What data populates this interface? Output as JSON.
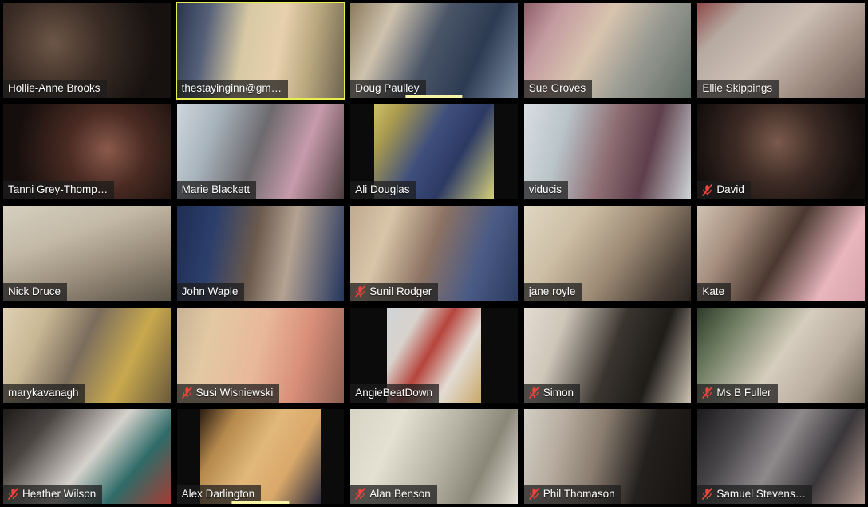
{
  "app": {
    "title": "Video Conference Gallery View",
    "layout": "gallery",
    "columns": 5,
    "rows": 5,
    "background_color": "#000000",
    "active_speaker_border_color": "#e9ef4a",
    "active_speaker_glow_color": "#7ddf22",
    "label_background_color": "rgba(28,28,28,0.74)",
    "label_text_color": "#ffffff",
    "muted_icon_color": "#e8453c",
    "audio_bar_color": "#f7f4a8",
    "participant_count": 25
  },
  "participants": [
    {
      "name": "Hollie-Anne Brooks",
      "muted": false,
      "active_speaker": false,
      "audio_bar": false,
      "mic_icon": "microphone-icon",
      "video": "full",
      "scene": "radial-gradient(circle at 30% 42%, #6d5648 0%, #3b2d25 38%, #171210 78%), linear-gradient(140deg,#9b9277 0%, #5c5443 46%, #1a1613 100%)"
    },
    {
      "name": "thestayinginn@gm…",
      "muted": false,
      "active_speaker": true,
      "audio_bar": false,
      "mic_icon": "microphone-icon",
      "video": "full",
      "scene": "linear-gradient(100deg,#2a3450 0%, #556078 18%, #d8c9a4 40%, #e7d0ae 60%, #b9a77f 78%, #6d6450 100%)"
    },
    {
      "name": "Doug Paulley",
      "muted": false,
      "active_speaker": false,
      "audio_bar": true,
      "mic_icon": "microphone-icon",
      "video": "full",
      "scene": "linear-gradient(115deg,#8b7a5e 0%, #cfc3ae 22%, #4a5568 48%, #2d3b52 72%, #7e8ea3 100%)"
    },
    {
      "name": "Sue Groves",
      "muted": false,
      "active_speaker": false,
      "audio_bar": false,
      "mic_icon": "microphone-icon",
      "video": "full",
      "scene": "linear-gradient(120deg,#8e5f68 0%, #c39aa0 18%, #d8c4ae 42%, #9a9b93 66%, #5e6b63 100%)"
    },
    {
      "name": "Ellie Skippings",
      "muted": false,
      "active_speaker": false,
      "audio_bar": false,
      "mic_icon": "microphone-icon",
      "video": "full",
      "scene": "linear-gradient(135deg,#8e4a4a 0%, #b6a9a0 20%, #cdbfb4 46%, #a39186 70%, #6e5c55 100%)"
    },
    {
      "name": "Tanni Grey-Thomp…",
      "muted": false,
      "active_speaker": false,
      "audio_bar": false,
      "mic_icon": "microphone-icon",
      "video": "full",
      "scene": "radial-gradient(circle at 62% 48%, #8a5a4b 0%, #4a2b23 34%, #150e0c 80%), linear-gradient(150deg,#3a221c 0%, #0c0808 100%)"
    },
    {
      "name": "Marie Blackett",
      "muted": false,
      "active_speaker": false,
      "audio_bar": false,
      "mic_icon": "microphone-icon",
      "video": "full",
      "scene": "linear-gradient(110deg,#cfd6dc 0%, #a8b4bd 22%, #6d6a6e 48%, #c79bab 72%, #4a3c3f 100%)"
    },
    {
      "name": "Ali Douglas",
      "muted": false,
      "active_speaker": false,
      "audio_bar": false,
      "mic_icon": "microphone-icon",
      "video": "pillar-wide",
      "scene": "linear-gradient(120deg,#cfc168 0%, #a99a4f 16%, #3f4f7d 44%, #2c3a63 66%, #d6cf7e 100%)"
    },
    {
      "name": "viducis",
      "muted": false,
      "active_speaker": false,
      "audio_bar": false,
      "mic_icon": "microphone-icon",
      "video": "full",
      "scene": "linear-gradient(105deg,#d8dde2 0%, #b9c4c9 24%, #8f6f74 50%, #5e3f4b 72%, #cfd6d9 100%)"
    },
    {
      "name": "David",
      "muted": true,
      "active_speaker": false,
      "audio_bar": false,
      "mic_icon": "microphone-muted-icon",
      "video": "full",
      "scene": "radial-gradient(circle at 48% 40%, #7a5a4c 0%, #3c2a24 40%, #130e0c 82%), linear-gradient(160deg,#2a1d18 0%, #0a0707 100%)"
    },
    {
      "name": "Nick Druce",
      "muted": false,
      "active_speaker": false,
      "audio_bar": false,
      "mic_icon": "microphone-icon",
      "video": "full",
      "scene": "linear-gradient(160deg,#d6cfc0 0%, #c3b9a6 34%, #9c8f7d 62%, #5a5348 100%)"
    },
    {
      "name": "John Waple",
      "muted": false,
      "active_speaker": false,
      "audio_bar": false,
      "mic_icon": "microphone-icon",
      "video": "full",
      "scene": "linear-gradient(100deg,#1e2d52 0%, #2c3f6b 22%, #6b5a4d 46%, #b5a392 66%, #23355e 100%)"
    },
    {
      "name": "Sunil Rodger",
      "muted": true,
      "active_speaker": false,
      "audio_bar": false,
      "mic_icon": "microphone-muted-icon",
      "video": "full",
      "scene": "linear-gradient(110deg,#bfa98f 0%, #d9c6a8 22%, #8c7263 48%, #4a5b86 74%, #2a3a5e 100%)"
    },
    {
      "name": "jane royle",
      "muted": false,
      "active_speaker": false,
      "audio_bar": false,
      "mic_icon": "microphone-icon",
      "video": "full",
      "scene": "linear-gradient(125deg,#e0d6c2 0%, #cdbfa6 28%, #9c8a74 56%, #4b4038 84%, #2a2420 100%)"
    },
    {
      "name": "Kate",
      "muted": false,
      "active_speaker": false,
      "audio_bar": false,
      "mic_icon": "microphone-icon",
      "video": "full",
      "scene": "linear-gradient(120deg,#cfc2b2 0%, #a58d7d 24%, #4a3830 50%, #e8b6bd 78%, #d9a2ab 100%)"
    },
    {
      "name": "marykavanagh",
      "muted": false,
      "active_speaker": false,
      "audio_bar": false,
      "mic_icon": "microphone-icon",
      "video": "full",
      "scene": "linear-gradient(115deg,#ded0b4 0%, #c9b894 22%, #7b6d5d 46%, #c9a94e 72%, #6a5a3c 100%)"
    },
    {
      "name": "Susi Wisniewski",
      "muted": true,
      "active_speaker": false,
      "audio_bar": false,
      "mic_icon": "microphone-muted-icon",
      "video": "full",
      "scene": "linear-gradient(105deg,#c8b294 0%, #e2c9a4 20%, #e9b89a 48%, #d98f7a 72%, #8c5f50 100%)"
    },
    {
      "name": "AngieBeatDown",
      "muted": false,
      "active_speaker": false,
      "audio_bar": false,
      "mic_icon": "microphone-icon",
      "video": "pillar",
      "scene": "linear-gradient(120deg,#cfd4d8 0%, #d8d2cc 24%, #b6443c 46%, #e3dcd4 70%, #c9a86a 100%)"
    },
    {
      "name": "Simon",
      "muted": true,
      "active_speaker": false,
      "audio_bar": false,
      "mic_icon": "microphone-muted-icon",
      "video": "full",
      "scene": "linear-gradient(110deg,#e3dbd0 0%, #cfc6ba 22%, #3a352f 52%, #1f1c19 74%, #cdc3b4 100%)"
    },
    {
      "name": "Ms B Fuller",
      "muted": true,
      "active_speaker": false,
      "audio_bar": false,
      "mic_icon": "microphone-muted-icon",
      "video": "full",
      "scene": "linear-gradient(125deg,#2e3a2a 0%, #6b7a5e 20%, #d6cdbe 50%, #b9ada0 74%, #6d6456 100%)"
    },
    {
      "name": "Heather Wilson",
      "muted": true,
      "active_speaker": false,
      "audio_bar": false,
      "mic_icon": "microphone-muted-icon",
      "video": "full",
      "scene": "linear-gradient(130deg,#1d1a18 0%, #4a4441 22%, #d6d2cc 52%, #2f6b68 74%, #a33c33 100%)"
    },
    {
      "name": "Alex Darlington",
      "muted": false,
      "active_speaker": false,
      "audio_bar": true,
      "mic_icon": "microphone-icon",
      "video": "pillar-wide",
      "scene": "linear-gradient(120deg,#2a1d12 0%, #b5884c 22%, #e2b87a 48%, #d9a86a 70%, #2c2a3a 100%)"
    },
    {
      "name": "Alan Benson",
      "muted": true,
      "active_speaker": false,
      "audio_bar": false,
      "mic_icon": "microphone-muted-icon",
      "video": "full",
      "scene": "linear-gradient(115deg,#d8d4c4 0%, #e4e0d2 26%, #b6b2a4 54%, #8a8678 76%, #e9e5da 100%)"
    },
    {
      "name": "Phil Thomason",
      "muted": true,
      "active_speaker": false,
      "audio_bar": false,
      "mic_icon": "microphone-muted-icon",
      "video": "full",
      "scene": "linear-gradient(105deg,#d2cec4 0%, #b8ada0 22%, #8a7d70 44%, #23201e 70%, #15120f 100%)"
    },
    {
      "name": "Samuel Stevens…",
      "muted": true,
      "active_speaker": false,
      "audio_bar": false,
      "mic_icon": "microphone-muted-icon",
      "video": "full",
      "scene": "linear-gradient(120deg,#1b1a1c 0%, #49464a 24%, #8e8a8c 48%, #3a373a 72%, #b49a90 100%)"
    }
  ]
}
